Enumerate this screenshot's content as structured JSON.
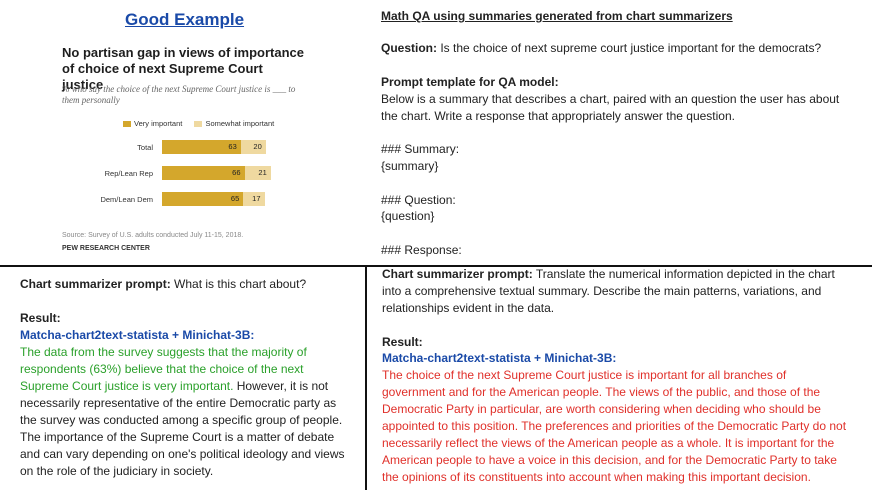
{
  "good_example": {
    "title": "Good Example",
    "chart": {
      "title": "No partisan gap in views of importance of choice of next Supreme Court justice",
      "subtitle": "% who say the choice of the next Supreme Court justice is ___ to them personally",
      "source": "Source: Survey of U.S. adults conducted July 11-15, 2018.",
      "credit": "PEW RESEARCH CENTER"
    }
  },
  "chart_data": {
    "type": "bar",
    "stacked": true,
    "orientation": "horizontal",
    "title": "No partisan gap in views of importance of choice of next Supreme Court justice",
    "subtitle": "% who say the choice of the next Supreme Court justice is ___ to them personally",
    "categories": [
      "Total",
      "Rep/Lean Rep",
      "Dem/Lean Dem"
    ],
    "series": [
      {
        "name": "Very important",
        "values": [
          63,
          66,
          65
        ],
        "color": "#d4a72c"
      },
      {
        "name": "Somewhat important",
        "values": [
          20,
          21,
          17
        ],
        "color": "#efd9a0"
      }
    ],
    "legend_position": "top",
    "grid": false
  },
  "math_qa": {
    "title": "Math QA using summaries generated from chart summarizers",
    "question_label": "Question:",
    "question_text": "Is the choice of next supreme court justice important for the democrats?",
    "prompt_label": "Prompt template for QA model:",
    "prompt_line1": "Below is a summary that describes a chart, paired with an question the user has about",
    "prompt_line2": "the chart. Write a response that appropriately answer the question.",
    "summary_header": "### Summary:",
    "summary_var": "{summary}",
    "question_header": "### Question:",
    "question_var": "{question}",
    "response_header": "### Response:"
  },
  "bottom_left": {
    "prompt_label": "Chart summarizer prompt:",
    "prompt_text": "What is this chart about?",
    "result_label": "Result:",
    "model": "Matcha-chart2text-statista + Minichat-3B:",
    "green_lines": [
      "The data from the survey suggests that the majority of",
      "respondents (63%) believe that the choice of the next",
      "Supreme Court justice is very important."
    ],
    "black_tail": "However, it is not",
    "black_lines": [
      "necessarily representative of the entire Democratic party as",
      "the survey was conducted among a specific group of people.",
      "The importance of the Supreme Court is a matter of debate",
      "and can vary depending on one's political ideology and views",
      "on the role of the judiciary in society."
    ]
  },
  "bottom_right": {
    "prompt_label": "Chart summarizer prompt:",
    "prompt_lines": [
      "Translate the numerical information depicted in the chart",
      "into a comprehensive textual summary. Describe the main patterns, variations, and",
      "relationships evident in the data."
    ],
    "result_label": "Result:",
    "model": "Matcha-chart2text-statista + Minichat-3B:",
    "red_lines": [
      "The choice of the next Supreme Court justice is important for all branches of",
      "government and for the American people. The views of the public, and those of the",
      "Democratic Party in particular, are worth considering when deciding who should be",
      "appointed to this position. The preferences and priorities of the Democratic Party do not",
      "necessarily reflect the views of the American people as a whole. It is important for the",
      "American people to have a voice in this decision, and for the Democratic Party to take",
      "the opinions of its constituents into account when making this important decision."
    ]
  }
}
